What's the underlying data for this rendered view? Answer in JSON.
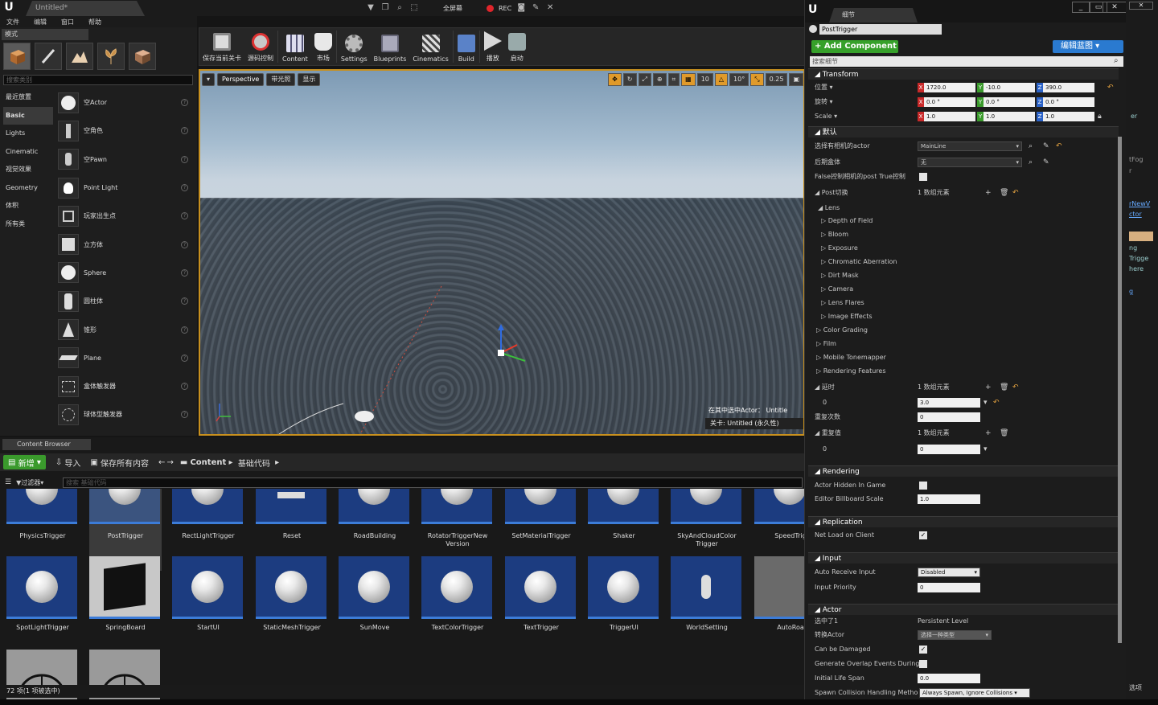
{
  "window": {
    "doc_tab": "Untitled*",
    "menu": [
      "文件",
      "编辑",
      "窗口",
      "帮助"
    ],
    "rec": "REC",
    "center_label": "全屏幕"
  },
  "modes": {
    "tab": "模式",
    "search_placeholder": "搜索类别",
    "categories": [
      "最近放置",
      "Basic",
      "Lights",
      "Cinematic",
      "视觉效果",
      "Geometry",
      "体积",
      "所有类"
    ],
    "items": [
      "空Actor",
      "空角色",
      "空Pawn",
      "Point Light",
      "玩家出生点",
      "立方体",
      "Sphere",
      "圆柱体",
      "锥形",
      "Plane",
      "盒体触发器",
      "球体型触发器"
    ]
  },
  "toolbar": {
    "buttons": [
      "保存当前关卡",
      "源码控制",
      "Content",
      "市场",
      "Settings",
      "Blueprints",
      "Cinematics",
      "Build",
      "播放",
      "启动"
    ]
  },
  "viewport": {
    "perspective": "Perspective",
    "lit": "带光照",
    "show": "显示",
    "grid": "10",
    "rot": "10°",
    "scale": "0.25",
    "msg": "在其中选中Actor：  Untitle",
    "level": "关卡: Untitled (永久性)"
  },
  "content_browser": {
    "tab": "Content Browser",
    "new": "新增",
    "import": "导入",
    "save_all": "保存所有内容",
    "path_root": "Content",
    "path_sub": "基础代码",
    "filters": "过滤器",
    "search_placeholder": "搜索 基础代码",
    "row1": [
      "PhysicsTrigger",
      "PostTrigger",
      "RectLightTrigger",
      "Reset",
      "RoadBuilding",
      "RotatorTriggerNew Version",
      "SetMaterialTrigger",
      "Shaker",
      "SkyAndCloudColor Trigger",
      "SpeedTrig"
    ],
    "row2": [
      "SpotLightTrigger",
      "SpringBoard",
      "StartUI",
      "StaticMeshTrigger",
      "SunMove",
      "TextColorTrigger",
      "TextTrigger",
      "TriggerUI",
      "WorldSetting",
      "AutoRoa"
    ],
    "status": "72 项(1 项被选中)"
  },
  "details": {
    "tab": "细节",
    "name": "PostTrigger",
    "add_component": "+ Add Component ▾",
    "edit_bp": "编辑蓝图 ▾",
    "search_placeholder": "搜索细节",
    "transform": {
      "header": "Transform",
      "location": "位置 ▾",
      "rotation": "旋转 ▾",
      "scale": "Scale ▾",
      "loc": [
        "1720.0",
        "-10.0",
        "390.0"
      ],
      "rot": [
        "0.0 °",
        "0.0 °",
        "0.0 °"
      ],
      "scl": [
        "1.0",
        "1.0",
        "1.0"
      ]
    },
    "default": {
      "header": "默认",
      "camera_actor": "选择有相机的actor",
      "camera_val": "MainLine",
      "post_volume": "后期盒体",
      "post_val": "无",
      "false_label": "False控制相机的post  True控制",
      "post_switch": "Post切换",
      "array_count": "1 数组元素",
      "lens": "Lens",
      "lens_items": [
        "Depth of Field",
        "Bloom",
        "Exposure",
        "Chromatic Aberration",
        "Dirt Mask",
        "Camera",
        "Lens Flares",
        "Image Effects"
      ],
      "other_items": [
        "Color Grading",
        "Film",
        "Mobile Tonemapper",
        "Rendering Features"
      ],
      "delay": "延时",
      "idx0": "0",
      "delay_val": "3.0",
      "repeat": "重复次数",
      "repeat_val": "0",
      "reset": "重复值",
      "reset_val": "0"
    },
    "rendering": {
      "header": "Rendering",
      "hidden": "Actor Hidden In Game",
      "billboard": "Editor Billboard Scale",
      "billboard_val": "1.0"
    },
    "replication": {
      "header": "Replication",
      "net": "Net Load on Client"
    },
    "input": {
      "header": "Input",
      "auto": "Auto Receive Input",
      "auto_val": "Disabled",
      "priority": "Input Priority",
      "priority_val": "0"
    },
    "actor": {
      "header": "Actor",
      "selected_in": "选中了1",
      "selected_val": "Persistent Level",
      "convert": "转换Actor",
      "convert_val": "选择一种类型",
      "damaged": "Can be Damaged",
      "overlap": "Generate Overlap Events During",
      "lifespan": "Initial Life Span",
      "lifespan_val": "0.0",
      "spawn": "Spawn Collision Handling Metho",
      "spawn_val": "Always Spawn, Ignore Collisions"
    }
  },
  "right_strip": {
    "lines": [
      "er",
      "tFog",
      "r",
      "rNewV",
      "ctor",
      "ng",
      "Trigge",
      "here",
      "g",
      "选项"
    ]
  }
}
